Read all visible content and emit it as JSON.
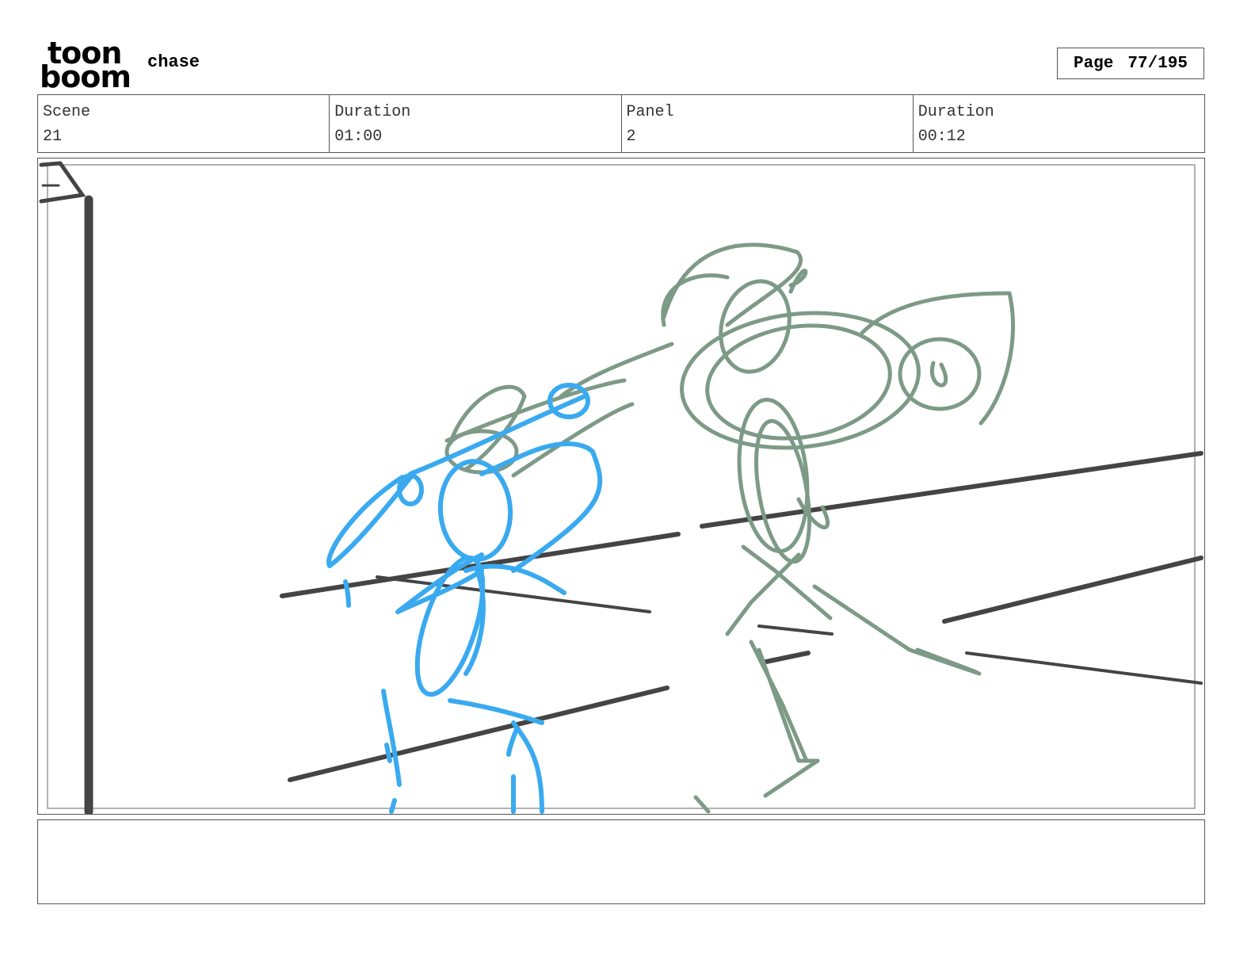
{
  "header": {
    "logo": {
      "line1": "toon",
      "line2": "boom"
    },
    "project_title": "chase",
    "page": {
      "label": "Page",
      "value": "77/195"
    }
  },
  "info": {
    "scene_label": "Scene",
    "scene_value": "21",
    "scene_duration_label": "Duration",
    "scene_duration_value": "01:00",
    "panel_label": "Panel",
    "panel_value": "2",
    "panel_duration_label": "Duration",
    "panel_duration_value": "00:12"
  },
  "notes": {
    "text": ""
  },
  "colors": {
    "blue_sketch": "#3aaaf0",
    "green_sketch": "#7d9a87",
    "background_lines": "#444444"
  }
}
